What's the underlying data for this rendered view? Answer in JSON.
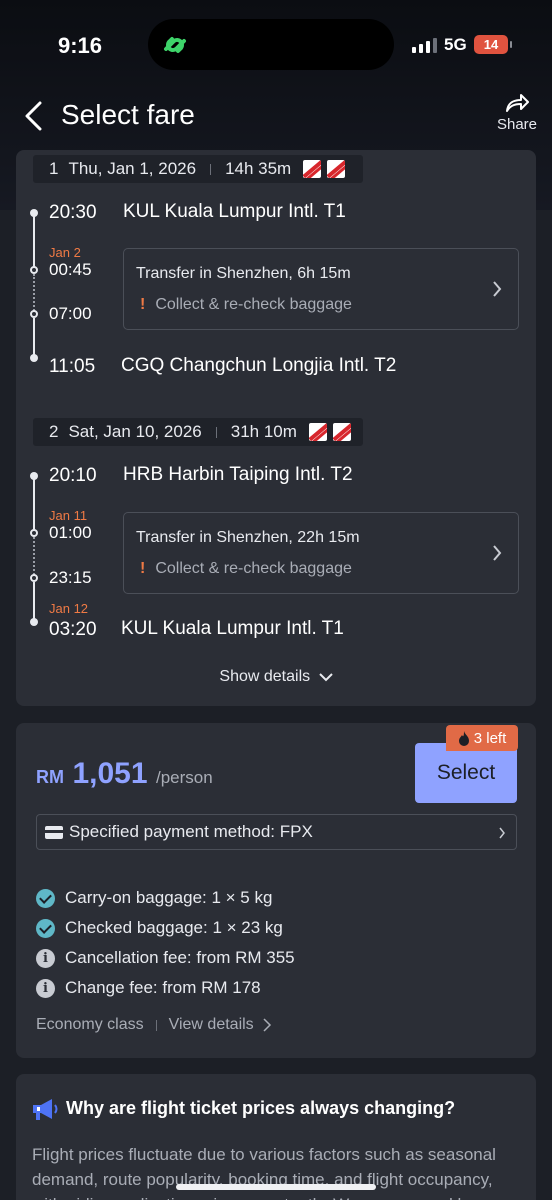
{
  "status_bar": {
    "time": "9:16",
    "network": "5G",
    "battery": "14"
  },
  "header": {
    "title": "Select fare",
    "share_label": "Share"
  },
  "segments": [
    {
      "index": "1",
      "date": "Thu, Jan 1, 2026",
      "duration": "14h 35m",
      "depart_time": "20:30",
      "depart_airport": "KUL Kuala Lumpur Intl. T1",
      "transfer_arrive_date": "Jan 2",
      "transfer_arrive_time": "00:45",
      "transfer_depart_time": "07:00",
      "transfer_text": "Transfer in Shenzhen, 6h 15m",
      "transfer_note": "Collect & re-check baggage",
      "arrive_date": "",
      "arrive_time": "11:05",
      "arrive_airport": "CGQ Changchun Longjia Intl. T2"
    },
    {
      "index": "2",
      "date": "Sat, Jan 10, 2026",
      "duration": "31h 10m",
      "depart_time": "20:10",
      "depart_airport": "HRB Harbin Taiping Intl. T2",
      "transfer_arrive_date": "Jan 11",
      "transfer_arrive_time": "01:00",
      "transfer_depart_time": "23:15",
      "transfer_text": "Transfer in Shenzhen, 22h 15m",
      "transfer_note": "Collect & re-check baggage",
      "arrive_date": "Jan 12",
      "arrive_time": "03:20",
      "arrive_airport": "KUL Kuala Lumpur Intl. T1"
    }
  ],
  "show_details": "Show details",
  "fare": {
    "currency": "RM",
    "amount": "1,051",
    "per": "/person",
    "seats_left": "3 left",
    "select_label": "Select",
    "payment_method": "Specified payment method: FPX",
    "features": [
      {
        "icon": "check-icon",
        "text": "Carry-on baggage: 1 × 5 kg"
      },
      {
        "icon": "check-icon",
        "text": "Checked baggage: 1 × 23 kg"
      },
      {
        "icon": "info-icon",
        "text": "Cancellation fee: from RM 355"
      },
      {
        "icon": "info-icon",
        "text": "Change fee: from RM 178"
      }
    ],
    "cabin_class": "Economy class",
    "view_details": "View details"
  },
  "info": {
    "title": "Why are flight ticket prices always changing?",
    "body": "Flight prices fluctuate due to various factors such as seasonal demand, route popularity, booking time, and flight occupancy, with airlines adjusting prices constantly. We recommend bo"
  },
  "colors": {
    "accent": "#8fa2ff",
    "warning": "#ef7a45",
    "badge": "#e16a46",
    "check": "#5fb7c7",
    "card": "#2b2e36"
  }
}
